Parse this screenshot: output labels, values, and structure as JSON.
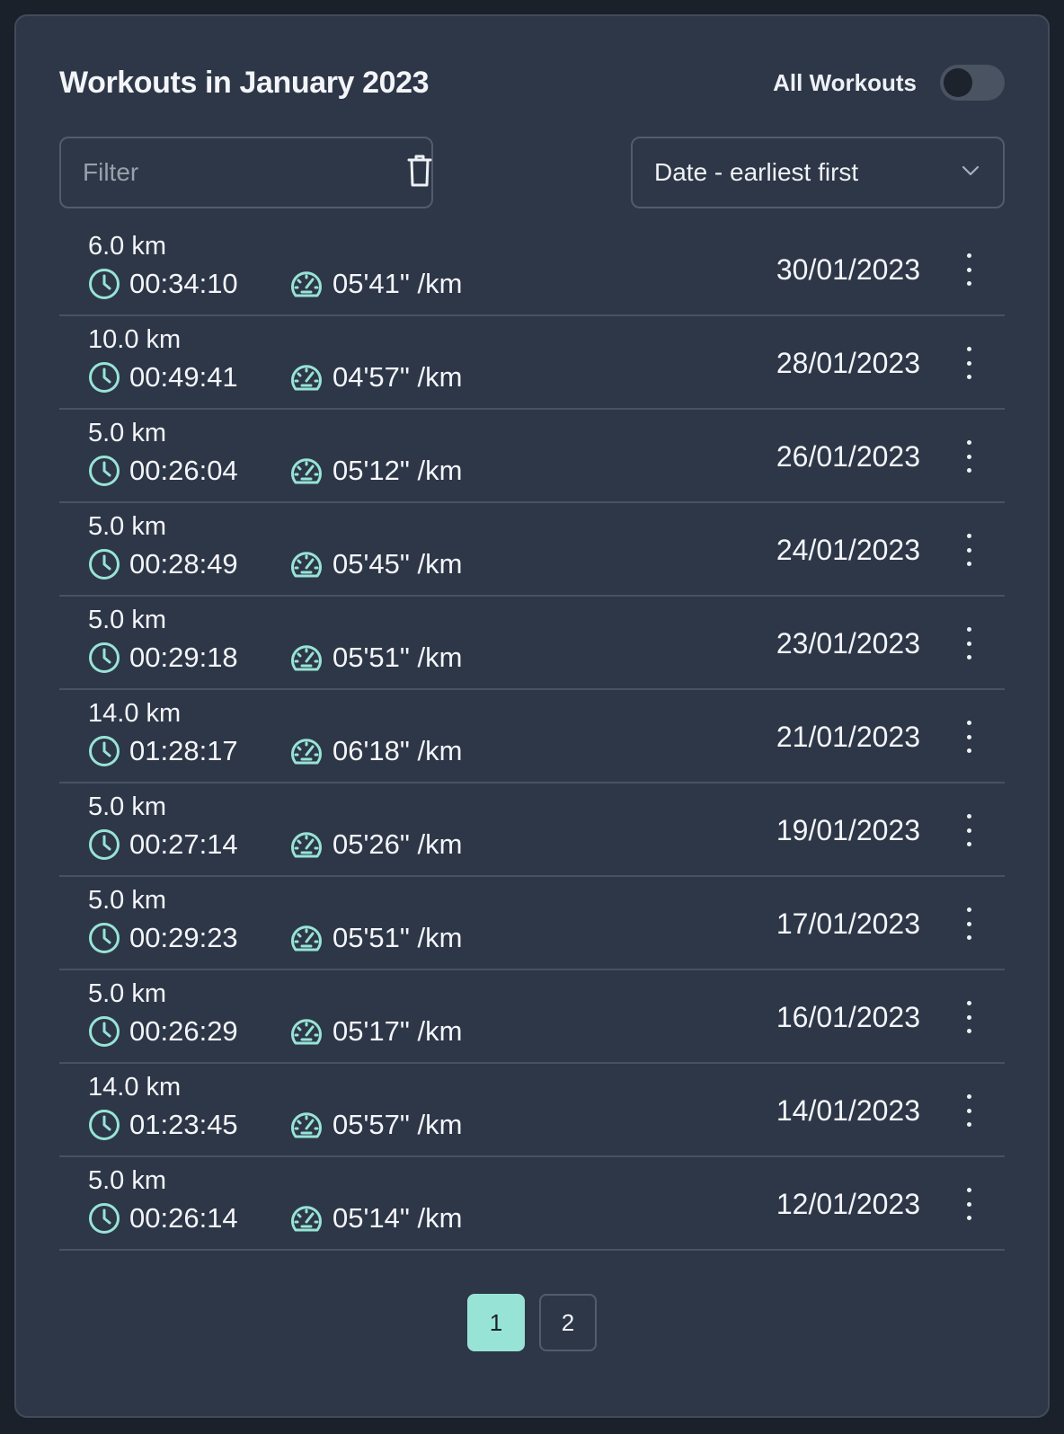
{
  "header": {
    "title": "Workouts in January 2023",
    "toggle_label": "All Workouts",
    "toggle_on": false
  },
  "filter": {
    "placeholder": "Filter",
    "value": ""
  },
  "sort": {
    "selected": "Date - earliest first"
  },
  "colors": {
    "accent": "#97e4d7",
    "panel": "#2e3747",
    "background": "#1b212b"
  },
  "icons": {
    "duration": "clock-icon",
    "pace": "speedometer-icon",
    "clear": "trash-icon",
    "menu": "more-vertical-icon",
    "dropdown": "chevron-down-icon"
  },
  "workouts": [
    {
      "distance": "6.0 km",
      "duration": "00:34:10",
      "pace": "05'41\" /km",
      "date": "30/01/2023"
    },
    {
      "distance": "10.0 km",
      "duration": "00:49:41",
      "pace": "04'57\" /km",
      "date": "28/01/2023"
    },
    {
      "distance": "5.0 km",
      "duration": "00:26:04",
      "pace": "05'12\" /km",
      "date": "26/01/2023"
    },
    {
      "distance": "5.0 km",
      "duration": "00:28:49",
      "pace": "05'45\" /km",
      "date": "24/01/2023"
    },
    {
      "distance": "5.0 km",
      "duration": "00:29:18",
      "pace": "05'51\" /km",
      "date": "23/01/2023"
    },
    {
      "distance": "14.0 km",
      "duration": "01:28:17",
      "pace": "06'18\" /km",
      "date": "21/01/2023"
    },
    {
      "distance": "5.0 km",
      "duration": "00:27:14",
      "pace": "05'26\" /km",
      "date": "19/01/2023"
    },
    {
      "distance": "5.0 km",
      "duration": "00:29:23",
      "pace": "05'51\" /km",
      "date": "17/01/2023"
    },
    {
      "distance": "5.0 km",
      "duration": "00:26:29",
      "pace": "05'17\" /km",
      "date": "16/01/2023"
    },
    {
      "distance": "14.0 km",
      "duration": "01:23:45",
      "pace": "05'57\" /km",
      "date": "14/01/2023"
    },
    {
      "distance": "5.0 km",
      "duration": "00:26:14",
      "pace": "05'14\" /km",
      "date": "12/01/2023"
    }
  ],
  "pagination": {
    "pages": [
      "1",
      "2"
    ],
    "current": "1"
  }
}
